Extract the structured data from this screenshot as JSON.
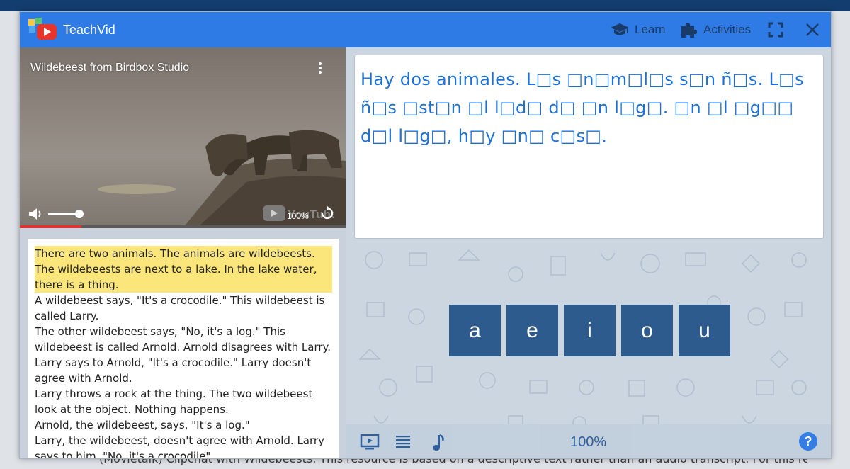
{
  "background": {
    "page_text": "(Movietalk) Clipchat with Wildebeests. This resource is based on a descriptive text rather than an audio transcript. For this reason it has been"
  },
  "titlebar": {
    "app_name": "TeachVid",
    "learn_label": "Learn",
    "activities_label": "Activities",
    "icons": [
      "graduation-cap-icon",
      "puzzle-icon",
      "fullscreen-icon",
      "close-icon"
    ],
    "color": "#2f7be5"
  },
  "video": {
    "title": "Wildebeest from Birdbox Studio",
    "speed": "100%",
    "volume_level": 0.85,
    "progress": 0.19,
    "youtube_logo": "YouTube"
  },
  "transcript": {
    "highlighted": "There are two animals. The animals are wildebeests. The wildebeests are next to a lake. In the lake water, there is a thing.",
    "lines": [
      "A wildebeest says, \"It's a crocodile.\" This wildebeest is called Larry.",
      "The other wildebeest says, \"No, it's a log.\" This wildebeest is called Arnold. Arnold disagrees with Larry.",
      "Larry says to Arnold, \"It's a crocodile.\" Larry doesn't agree with Arnold.",
      "Larry throws a rock at the thing. The two wildebeest look at the object. Nothing happens.",
      "Arnold, the wildebeest, says, \"It's a log.\"",
      "Larry, the wildebeest, doesn't agree with Arnold. Larry says to him, \"No, it's a crocodile\""
    ]
  },
  "exercise": {
    "text": "Hay dos animales. L□s □n□m□l□s s□n ñ□s. L□s ñ□s □st□n □l l□d□ d□ □n l□g□. □n □l □g□□ d□l l□g□, h□y □n□ c□s□.",
    "vowels": [
      "a",
      "e",
      "i",
      "o",
      "u"
    ],
    "text_color": "#1e70d6",
    "button_color": "#2e5b8e"
  },
  "bottombar": {
    "zoom": "100%",
    "help": "?",
    "icons": [
      "video-icon",
      "list-icon",
      "music-note-icon",
      "help-icon"
    ]
  }
}
